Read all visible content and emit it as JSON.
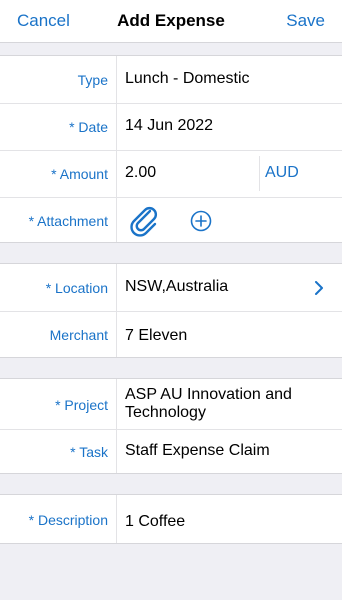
{
  "nav": {
    "cancel": "Cancel",
    "title": "Add Expense",
    "save": "Save"
  },
  "accent": "#1a73c8",
  "fields": {
    "type": {
      "label": "Type",
      "value": "Lunch - Domestic"
    },
    "date": {
      "label": "* Date",
      "value": "14 Jun 2022"
    },
    "amount": {
      "label": "* Amount",
      "value": "2.00",
      "currency": "AUD"
    },
    "attachment": {
      "label": "* Attachment",
      "icons": [
        "paperclip-icon",
        "add-circle-icon"
      ]
    },
    "location": {
      "label": "* Location",
      "value": "NSW,Australia"
    },
    "merchant": {
      "label": "Merchant",
      "value": "7 Eleven"
    },
    "project": {
      "label": "* Project",
      "value": "ASP AU Innovation and Technology"
    },
    "task": {
      "label": "* Task",
      "value": "Staff Expense Claim"
    },
    "description": {
      "label": "* Description",
      "value": "1 Coffee"
    }
  }
}
